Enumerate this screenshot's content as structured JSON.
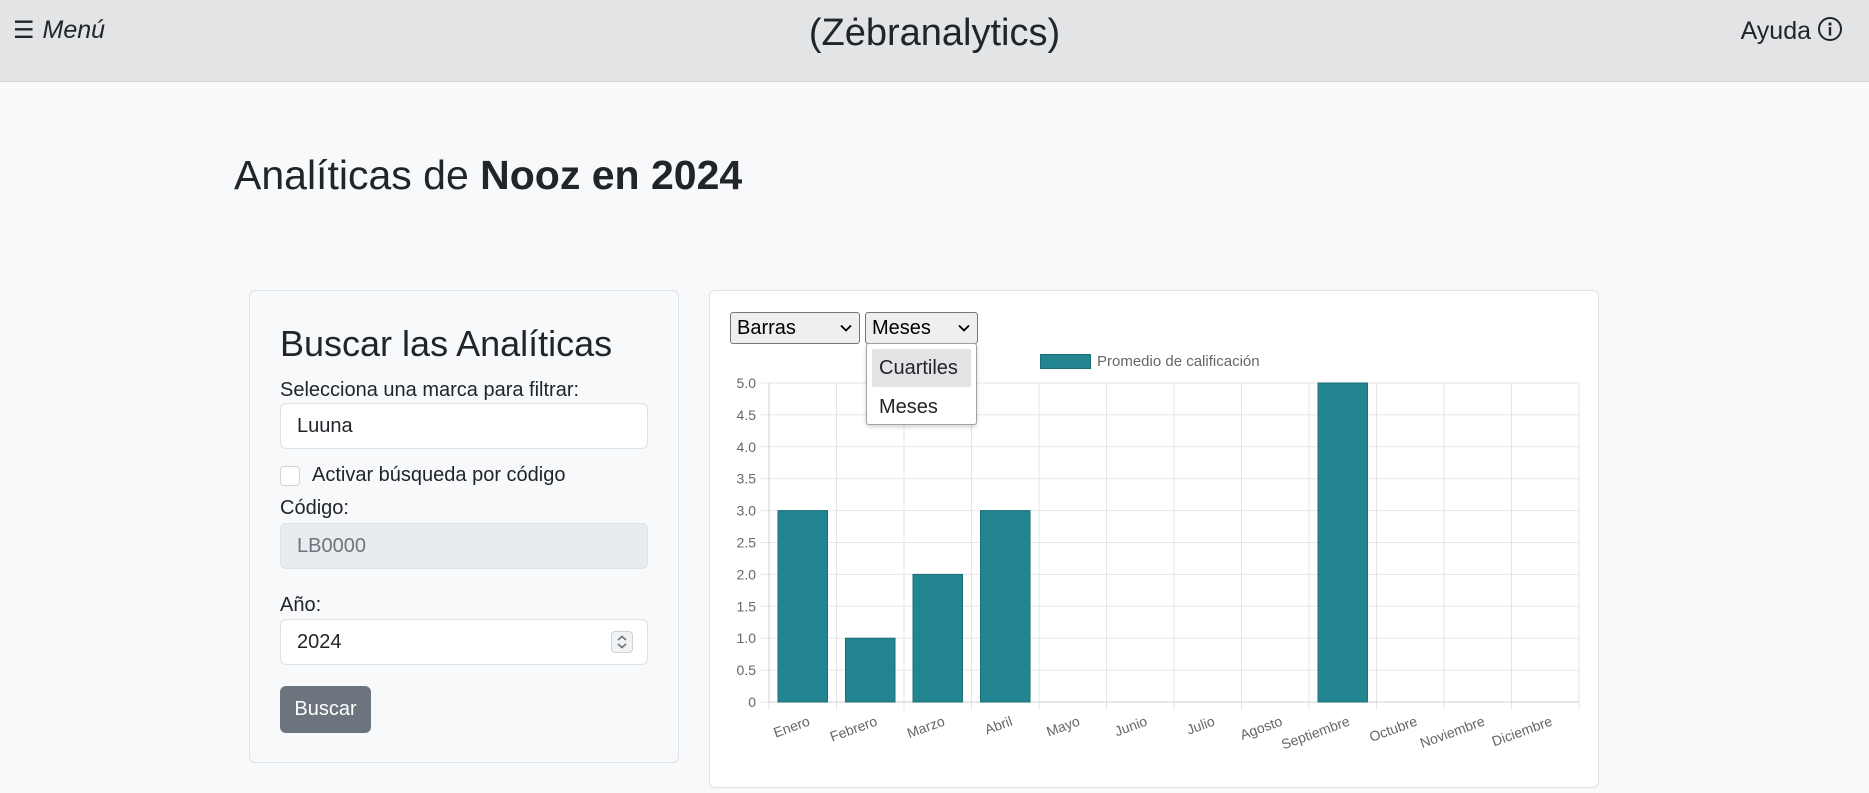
{
  "header": {
    "menu_label": "Menú",
    "brand": "(Zėbranalytics)",
    "help_label": "Ayuda"
  },
  "page": {
    "title_prefix": "Analíticas de",
    "title_strong": "Nooz en 2024"
  },
  "search": {
    "heading": "Buscar las Analíticas",
    "brand_label": "Selecciona una marca para filtrar:",
    "brand_value": "Luuna",
    "code_toggle_label": "Activar búsqueda por código",
    "code_label": "Código:",
    "code_value": "LB0000",
    "year_label": "Año:",
    "year_value": "2024",
    "submit_label": "Buscar"
  },
  "controls": {
    "chart_type_selected": "Barras",
    "period_selected": "Meses",
    "period_options": [
      "Cuartiles",
      "Meses"
    ]
  },
  "colors": {
    "bar": "#238591",
    "bar_border": "#1c6f79",
    "button": "#6c757d"
  },
  "chart_data": {
    "type": "bar",
    "categories": [
      "Enero",
      "Febrero",
      "Marzo",
      "Abril",
      "Mayo",
      "Junio",
      "Julio",
      "Agosto",
      "Septiembre",
      "Octubre",
      "Noviembre",
      "Diciembre"
    ],
    "series": [
      {
        "name": "Promedio de calificación",
        "values": [
          3,
          1,
          2,
          3,
          0,
          0,
          0,
          0,
          5,
          0,
          0,
          0
        ]
      }
    ],
    "ylim": [
      0,
      5
    ],
    "yticks": [
      "0",
      "0.5",
      "1.0",
      "1.5",
      "2.0",
      "2.5",
      "3.0",
      "3.5",
      "4.0",
      "4.5",
      "5.0"
    ],
    "grid": true,
    "legend_position": "top"
  }
}
